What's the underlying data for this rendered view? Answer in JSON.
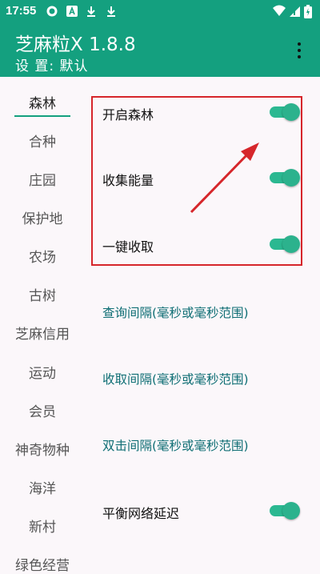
{
  "status_bar": {
    "time": "17:55"
  },
  "app_bar": {
    "title": "芝麻粒X 1.8.8",
    "subtitle": "设 置: 默认"
  },
  "sidebar": {
    "items": [
      {
        "label": "森林",
        "active": true
      },
      {
        "label": "合种"
      },
      {
        "label": "庄园"
      },
      {
        "label": "保护地"
      },
      {
        "label": "农场"
      },
      {
        "label": "古树"
      },
      {
        "label": "芝麻信用"
      },
      {
        "label": "运动"
      },
      {
        "label": "会员"
      },
      {
        "label": "神奇物种"
      },
      {
        "label": "海洋"
      },
      {
        "label": "新村"
      },
      {
        "label": "绿色经营"
      }
    ]
  },
  "settings": {
    "toggles": [
      {
        "label": "开启森林",
        "on": true
      },
      {
        "label": "收集能量",
        "on": true
      },
      {
        "label": "一键收取",
        "on": true
      }
    ],
    "links": [
      {
        "label": "查询间隔(毫秒或毫秒范围)"
      },
      {
        "label": "收取间隔(毫秒或毫秒范围)"
      },
      {
        "label": "双击间隔(毫秒或毫秒范围)"
      }
    ],
    "toggle_balance": {
      "label": "平衡网络延迟",
      "on": true
    }
  },
  "colors": {
    "accent": "#14a07f",
    "highlight": "#d6262b",
    "link": "#0e6e74"
  }
}
